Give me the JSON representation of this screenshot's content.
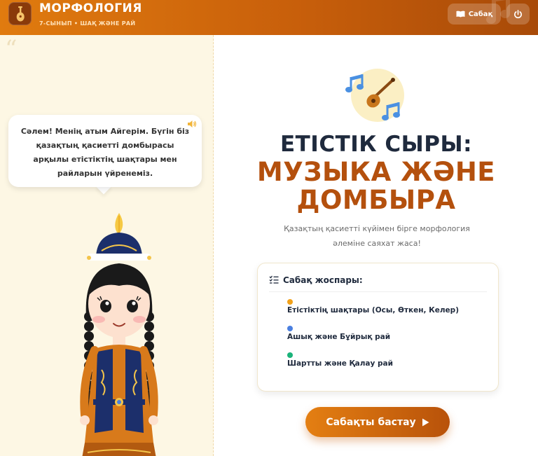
{
  "header": {
    "title": "МОРФОЛОГИЯ",
    "subtitle": "7-СЫНЫП • ШАҚ ЖӘНЕ РАЙ",
    "lesson_button": "Сабақ",
    "logo_icon": "dombra-icon",
    "lesson_icon": "book-icon",
    "power_icon": "power-icon"
  },
  "left": {
    "speech": "Сәлем! Менің атым Айгерім. Бүгін біз қазақтың қасиетті домбырасы арқылы етістіктің шақтары мен райларын үйренеміз.",
    "quote_mark": "“",
    "character": "girl-in-kazakh-costume"
  },
  "hero": {
    "line1": "ЕТІСТІК СЫРЫ:",
    "line2": "МУЗЫКА ЖӘНЕ",
    "line3": "ДОМБЫРА",
    "tagline": "Қазақтың қасиетті күйімен бірге морфология әлеміне саяхат жаса!"
  },
  "plan": {
    "title": "Сабақ жоспары:",
    "items": [
      {
        "label": "Етістіктің шақтары (Осы, Өткен, Келер)",
        "color": "#f2a21b"
      },
      {
        "label": "Ашық және Бұйрық рай",
        "color": "#4a7fe0"
      },
      {
        "label": "Шартты және Қалау рай",
        "color": "#1bb37a"
      }
    ]
  },
  "start_button": "Сабақты бастау",
  "colors": {
    "accent": "#c85f0b",
    "heading_dark": "#1f2a3d",
    "heading_brown": "#b4500d",
    "panel_bg": "#fdf7e4"
  }
}
